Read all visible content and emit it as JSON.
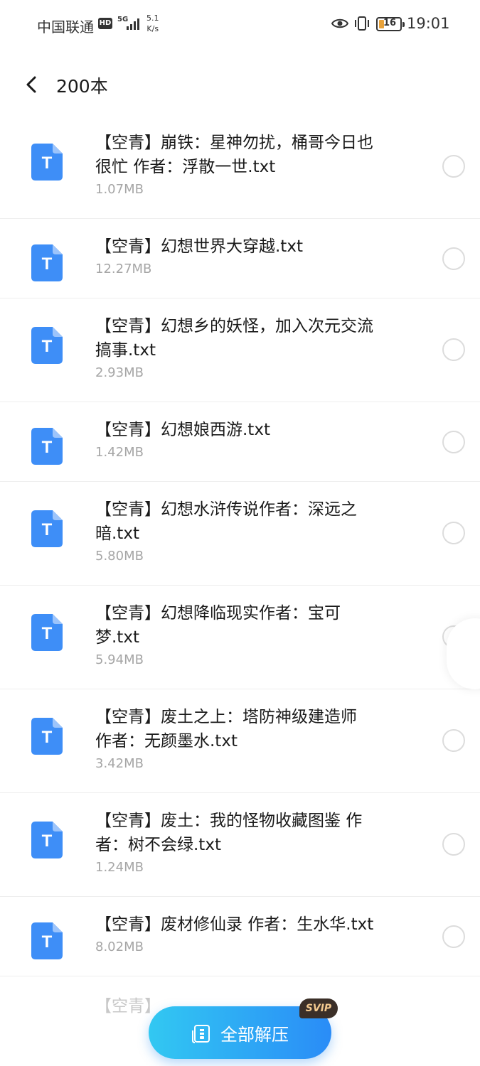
{
  "status_bar": {
    "carrier": "中国联通",
    "hd": "HD",
    "network": "5G",
    "speed_value": "5.1",
    "speed_unit": "K/s",
    "battery": "16",
    "time": "19:01"
  },
  "header": {
    "title": "200本"
  },
  "files": [
    {
      "name_line1": "【空青】崩铁：星神勿扰，桶哥今日也",
      "name_line2": "很忙 作者：浮散一世.txt",
      "size": "1.07MB"
    },
    {
      "name_line1": "【空青】幻想世界大穿越.txt",
      "name_line2": "",
      "size": "12.27MB"
    },
    {
      "name_line1": "【空青】幻想乡的妖怪，加入次元交流",
      "name_line2": "搞事.txt",
      "size": "2.93MB"
    },
    {
      "name_line1": "【空青】幻想娘西游.txt",
      "name_line2": "",
      "size": "1.42MB"
    },
    {
      "name_line1": "【空青】幻想水浒传说作者：深远之",
      "name_line2": "暗.txt",
      "size": "5.80MB"
    },
    {
      "name_line1": "【空青】幻想降临现实作者：宝可",
      "name_line2": "梦.txt",
      "size": "5.94MB"
    },
    {
      "name_line1": "【空青】废土之上：塔防神级建造师",
      "name_line2": "作者：无颜墨水.txt",
      "size": "3.42MB"
    },
    {
      "name_line1": "【空青】废土：我的怪物收藏图鉴 作",
      "name_line2": "者：树不会绿.txt",
      "size": "1.24MB"
    },
    {
      "name_line1": "【空青】废材修仙录 作者：生水华.txt",
      "name_line2": "",
      "size": "8.02MB"
    }
  ],
  "partial_row": "【空青】…",
  "extract": {
    "label": "全部解压",
    "badge": "SVIP"
  },
  "colors": {
    "accent_start": "#32c8f2",
    "accent_end": "#2a8cf7",
    "file_icon": "#3e8ef7"
  },
  "icons": {
    "back": "chevron-left",
    "file": "txt-document",
    "extract": "archive-extract"
  }
}
